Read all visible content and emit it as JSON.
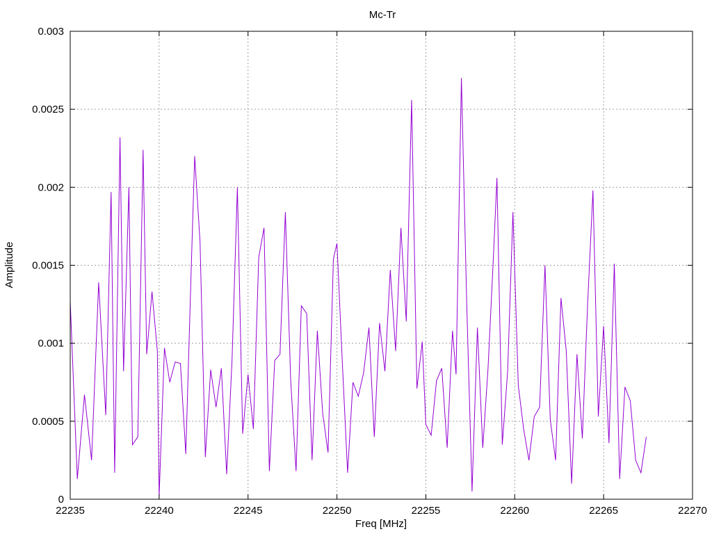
{
  "chart_data": {
    "type": "line",
    "title": "Mc-Tr",
    "xlabel": "Freq [MHz]",
    "ylabel": "Amplitude",
    "xlim": [
      22235,
      22270
    ],
    "ylim": [
      0,
      0.003
    ],
    "x_ticks": [
      "22235",
      "22240",
      "22245",
      "22250",
      "22255",
      "22260",
      "22265",
      "22270"
    ],
    "y_ticks": [
      "0",
      "0.0005",
      "0.001",
      "0.0015",
      "0.002",
      "0.0025",
      "0.003"
    ],
    "grid": true,
    "legend": "none",
    "colors": {
      "line": "#9400d3",
      "grid": "#a0a0a0",
      "axes": "#000000"
    },
    "series": [
      {
        "x": [
          22235.0,
          22235.4,
          22235.8,
          22236.2,
          22236.6,
          22237.0,
          22237.3,
          22237.5,
          22237.8,
          22238.0,
          22238.3,
          22238.5,
          22238.8,
          22239.1,
          22239.3,
          22239.6,
          22239.9,
          22240.0,
          22240.3,
          22240.6,
          22240.9,
          22241.2,
          22241.5,
          22241.8,
          22242.0,
          22242.3,
          22242.6,
          22242.9,
          22243.2,
          22243.5,
          22243.8,
          22244.1,
          22244.4,
          22244.7,
          22245.0,
          22245.3,
          22245.6,
          22245.9,
          22246.2,
          22246.5,
          22246.8,
          22247.1,
          22247.4,
          22247.7,
          22248.0,
          22248.3,
          22248.6,
          22248.9,
          22249.2,
          22249.5,
          22249.8,
          22250.0,
          22250.3,
          22250.6,
          22250.9,
          22251.2,
          22251.5,
          22251.8,
          22252.1,
          22252.4,
          22252.7,
          22253.0,
          22253.3,
          22253.6,
          22253.9,
          22254.2,
          22254.5,
          22254.8,
          22255.0,
          22255.3,
          22255.6,
          22255.9,
          22256.2,
          22256.5,
          22256.7,
          22257.0,
          22257.3,
          22257.6,
          22257.9,
          22258.2,
          22258.5,
          22258.8,
          22259.0,
          22259.3,
          22259.6,
          22259.9,
          22260.2,
          22260.5,
          22260.8,
          22261.1,
          22261.4,
          22261.7,
          22262.0,
          22262.3,
          22262.6,
          22262.9,
          22263.2,
          22263.5,
          22263.8,
          22264.1,
          22264.4,
          22264.7,
          22265.0,
          22265.3,
          22265.6,
          22265.9,
          22266.2,
          22266.5,
          22266.8,
          22267.1,
          22267.4
        ],
        "y": [
          0.00127,
          0.00013,
          0.00067,
          0.00025,
          0.00139,
          0.00054,
          0.00197,
          0.00017,
          0.00232,
          0.00082,
          0.002,
          0.00035,
          0.0004,
          0.00224,
          0.00093,
          0.00133,
          0.00095,
          2e-05,
          0.00097,
          0.00075,
          0.00088,
          0.00087,
          0.00029,
          0.00146,
          0.0022,
          0.00165,
          0.00027,
          0.00083,
          0.00059,
          0.00084,
          0.00016,
          0.00089,
          0.002,
          0.00042,
          0.0008,
          0.00045,
          0.00155,
          0.00174,
          0.00018,
          0.00089,
          0.00093,
          0.00184,
          0.00076,
          0.00018,
          0.00124,
          0.00119,
          0.00025,
          0.00108,
          0.00055,
          0.0003,
          0.00154,
          0.00164,
          0.00089,
          0.00017,
          0.00075,
          0.00066,
          0.00081,
          0.0011,
          0.0004,
          0.00113,
          0.00082,
          0.00147,
          0.00095,
          0.00174,
          0.00114,
          0.00256,
          0.00071,
          0.00101,
          0.00048,
          0.00041,
          0.00076,
          0.00084,
          0.00033,
          0.00108,
          0.0008,
          0.0027,
          0.00126,
          5e-05,
          0.0011,
          0.00033,
          0.00084,
          0.00155,
          0.00206,
          0.00035,
          0.00082,
          0.00184,
          0.00073,
          0.00045,
          0.00025,
          0.00053,
          0.00059,
          0.0015,
          0.00051,
          0.00025,
          0.00129,
          0.00095,
          0.0001,
          0.00093,
          0.00039,
          0.00125,
          0.00198,
          0.00053,
          0.00111,
          0.00036,
          0.00151,
          0.00013,
          0.00072,
          0.00063,
          0.00025,
          0.00017,
          0.0004
        ]
      }
    ]
  }
}
